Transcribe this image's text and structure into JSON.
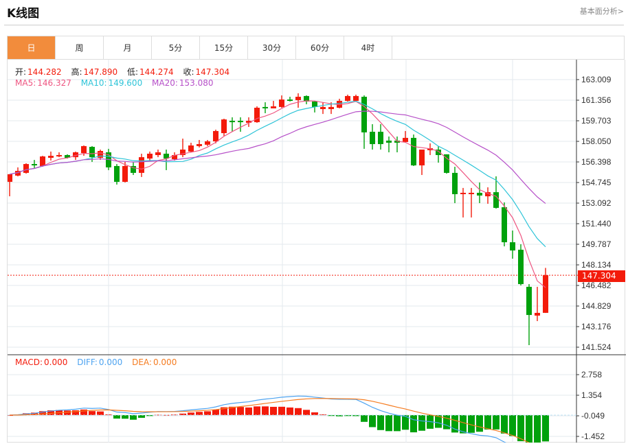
{
  "header": {
    "title": "K线图",
    "link": "基本面分析>"
  },
  "tabs": [
    {
      "label": "日",
      "active": true
    },
    {
      "label": "周"
    },
    {
      "label": "月"
    },
    {
      "label": "5分"
    },
    {
      "label": "15分"
    },
    {
      "label": "30分"
    },
    {
      "label": "60分"
    },
    {
      "label": "4时"
    }
  ],
  "ohlc": {
    "open_label": "开:",
    "open": "144.282",
    "high_label": "高:",
    "high": "147.890",
    "low_label": "低:",
    "low": "144.274",
    "close_label": "收:",
    "close": "147.304"
  },
  "ma": {
    "ma5_label": "MA5:",
    "ma5": "146.327",
    "ma10_label": "MA10:",
    "ma10": "149.600",
    "ma20_label": "MA20:",
    "ma20": "153.080"
  },
  "macd_legend": {
    "macd_label": "MACD:",
    "macd": "0.000",
    "diff_label": "DIFF:",
    "diff": "0.000",
    "dea_label": "DEA:",
    "dea": "0.000"
  },
  "colors": {
    "up": "#f31b0b",
    "down": "#00a10c",
    "ma5": "#ee5581",
    "ma10": "#2ec4d8",
    "ma20": "#b64fc8",
    "diff": "#4da3f0",
    "dea": "#f57b1f",
    "accent": "#f28c3c"
  },
  "chart_data": {
    "type": "candlestick",
    "current_price": "147.304",
    "price_ticks": [
      "163.009",
      "161.356",
      "159.703",
      "158.050",
      "156.398",
      "154.745",
      "153.092",
      "151.440",
      "149.787",
      "148.134",
      "146.482",
      "144.829",
      "143.176",
      "141.524"
    ],
    "price_range": [
      141.524,
      163.009
    ],
    "macd_ticks": [
      "2.758",
      "1.354",
      "-0.049",
      "-1.452"
    ],
    "macd_range": [
      -1.452,
      2.758
    ],
    "candles": [
      [
        154.8,
        155.41,
        155.41,
        153.64
      ],
      [
        155.3,
        155.68,
        155.96,
        155.24
      ],
      [
        155.52,
        156.23,
        156.29,
        155.46
      ],
      [
        156.23,
        156.18,
        156.56,
        155.85
      ],
      [
        156.07,
        156.84,
        156.89,
        156.01
      ],
      [
        156.73,
        156.89,
        157.23,
        156.51
      ],
      [
        156.84,
        156.95,
        157.17,
        156.78
      ],
      [
        156.95,
        156.73,
        157.01,
        156.67
      ],
      [
        156.78,
        157.17,
        157.23,
        156.56
      ],
      [
        157.11,
        157.67,
        157.72,
        156.89
      ],
      [
        157.61,
        156.78,
        157.67,
        156.4
      ],
      [
        156.73,
        157.28,
        157.39,
        156.56
      ],
      [
        157.17,
        155.96,
        157.45,
        155.74
      ],
      [
        156.07,
        154.8,
        156.23,
        154.58
      ],
      [
        154.8,
        156.07,
        156.4,
        154.75
      ],
      [
        156.07,
        155.52,
        156.4,
        155.35
      ],
      [
        155.52,
        156.78,
        157.06,
        155.19
      ],
      [
        156.67,
        157.06,
        157.23,
        156.51
      ],
      [
        156.95,
        157.17,
        157.39,
        156.78
      ],
      [
        157.06,
        156.67,
        157.39,
        155.74
      ],
      [
        156.62,
        156.95,
        157.17,
        156.51
      ],
      [
        156.95,
        157.39,
        158.27,
        156.78
      ],
      [
        157.23,
        157.72,
        157.94,
        157.17
      ],
      [
        157.67,
        157.83,
        158.16,
        157.56
      ],
      [
        157.78,
        158.05,
        158.16,
        157.67
      ],
      [
        158.05,
        158.88,
        158.99,
        157.89
      ],
      [
        158.71,
        159.81,
        159.87,
        158.49
      ],
      [
        159.7,
        159.59,
        159.98,
        158.82
      ],
      [
        159.7,
        159.59,
        159.98,
        158.82
      ],
      [
        159.54,
        159.7,
        159.98,
        159.21
      ],
      [
        159.59,
        160.75,
        160.86,
        159.54
      ],
      [
        160.81,
        160.75,
        161.19,
        160.31
      ],
      [
        160.7,
        160.86,
        161.3,
        160.7
      ],
      [
        160.81,
        161.41,
        161.74,
        160.75
      ],
      [
        161.41,
        161.36,
        161.63,
        161.25
      ],
      [
        161.36,
        161.63,
        161.91,
        160.75
      ],
      [
        161.69,
        161.25,
        161.74,
        161.03
      ],
      [
        161.25,
        160.81,
        161.3,
        160.37
      ],
      [
        160.64,
        160.81,
        161.19,
        160.25
      ],
      [
        160.64,
        160.81,
        161.19,
        160.25
      ],
      [
        160.75,
        161.3,
        161.47,
        160.7
      ],
      [
        161.3,
        161.69,
        161.8,
        161.25
      ],
      [
        161.3,
        161.69,
        161.8,
        161.25
      ],
      [
        161.63,
        158.77,
        161.74,
        157.45
      ],
      [
        158.82,
        157.83,
        159.43,
        157.39
      ],
      [
        158.82,
        157.83,
        159.43,
        157.39
      ],
      [
        158.11,
        157.94,
        158.44,
        157.17
      ],
      [
        158.11,
        157.94,
        158.44,
        157.17
      ],
      [
        158.0,
        158.33,
        158.88,
        157.94
      ],
      [
        158.33,
        156.12,
        158.6,
        156.07
      ],
      [
        156.12,
        157.39,
        157.39,
        155.35
      ],
      [
        157.34,
        157.5,
        157.89,
        156.95
      ],
      [
        157.39,
        156.95,
        157.67,
        156.34
      ],
      [
        157.01,
        155.52,
        157.01,
        155.46
      ],
      [
        155.52,
        153.81,
        156.01,
        153.09
      ],
      [
        153.81,
        153.92,
        154.31,
        151.94
      ],
      [
        153.81,
        153.92,
        154.31,
        151.94
      ],
      [
        153.92,
        153.7,
        154.75,
        153.09
      ],
      [
        153.64,
        153.97,
        154.36,
        153.04
      ],
      [
        153.97,
        152.71,
        155.24,
        152.65
      ],
      [
        152.76,
        149.95,
        153.15,
        149.62
      ],
      [
        149.95,
        149.29,
        150.89,
        148.63
      ],
      [
        149.35,
        146.59,
        149.79,
        146.48
      ],
      [
        146.37,
        144.11,
        146.59,
        141.69
      ],
      [
        144.06,
        144.28,
        146.37,
        143.62
      ],
      [
        144.282,
        147.304,
        147.89,
        144.274
      ]
    ]
  }
}
